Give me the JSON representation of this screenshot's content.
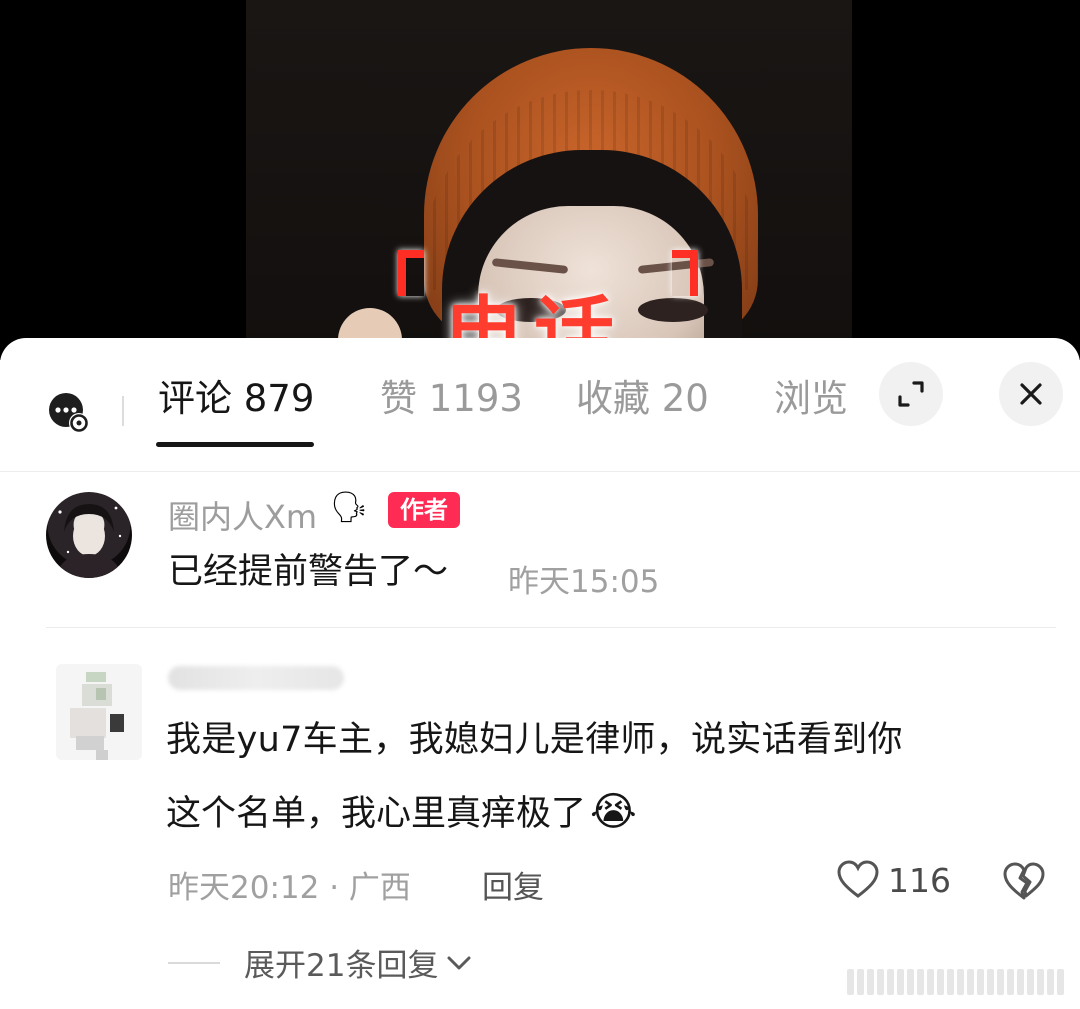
{
  "video": {
    "overlay_text": "电话"
  },
  "tabs": {
    "items": [
      {
        "label": "评论 879",
        "active": true
      },
      {
        "label": "赞 1193",
        "active": false
      },
      {
        "label": "收藏 20",
        "active": false
      },
      {
        "label": "浏览",
        "active": false
      }
    ],
    "expand_icon": "expand-icon",
    "close_icon": "close-icon",
    "chat_icon": "chat-settings-icon"
  },
  "comments": [
    {
      "username": "圈内人Xm",
      "username_emoji": "🗣",
      "badge": "作者",
      "text": "已经提前警告了～",
      "time": "昨天15:05"
    },
    {
      "username": "",
      "text_line1": "我是yu7车主，我媳妇儿是律师，说实话看到你",
      "text_line2": "这个名单，我心里真痒极了",
      "emoji": "😭",
      "time_location": "昨天20:12 · 广西",
      "reply_label": "回复",
      "like_count": "116",
      "like_icon": "heart-icon",
      "dislike_icon": "broken-heart-icon",
      "expand_label": "展开21条回复",
      "expand_icon": "chevron-down-icon"
    }
  ],
  "colors": {
    "accent": "#fe2c55",
    "text_primary": "#161616",
    "text_secondary": "#9d9d9d"
  }
}
